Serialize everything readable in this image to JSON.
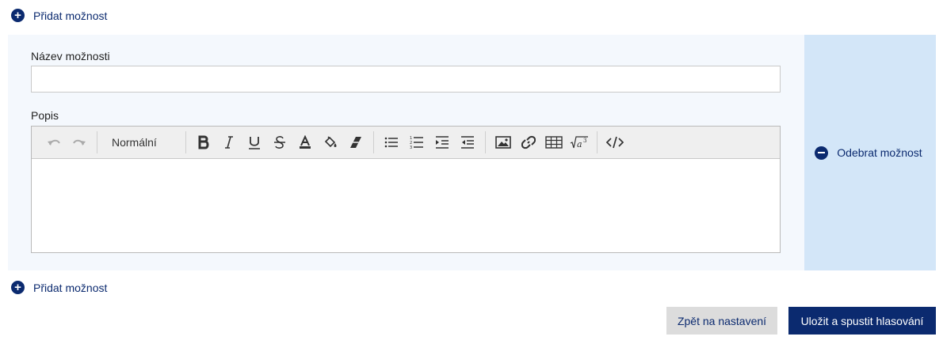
{
  "add_option_label": "Přidat možnost",
  "option": {
    "name_label": "Název možnosti",
    "name_value": "",
    "description_label": "Popis"
  },
  "editor": {
    "format_value": "Normální",
    "toolbar_icons": [
      "undo-icon",
      "redo-icon",
      "bold-icon",
      "italic-icon",
      "underline-icon",
      "strikethrough-icon",
      "text-color-icon",
      "background-color-icon",
      "clear-format-icon",
      "bullet-list-icon",
      "numbered-list-icon",
      "indent-icon",
      "outdent-icon",
      "image-icon",
      "link-icon",
      "table-icon",
      "formula-icon",
      "code-view-icon"
    ],
    "body_text": ""
  },
  "remove_option_label": "Odebrat možnost",
  "buttons": {
    "back": "Zpět na nastavení",
    "save": "Uložit a spustit hlasování"
  },
  "colors": {
    "brand": "#0b2a6f",
    "panel": "#f4f8fd",
    "remove_panel": "#d3e6f8"
  }
}
